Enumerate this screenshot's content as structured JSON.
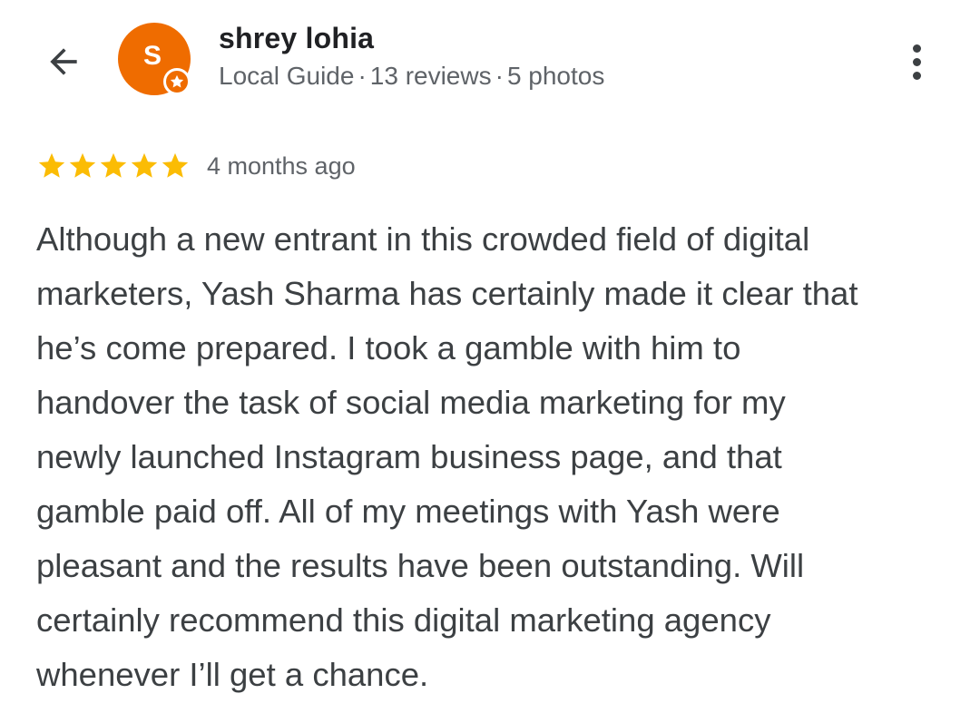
{
  "reviewer": {
    "name": "shrey lohia",
    "avatar_letter": "S",
    "avatar_color": "#ef6c00",
    "badge": "local-guide-star-icon",
    "meta": {
      "level": "Local Guide",
      "reviews": "13 reviews",
      "photos": "5 photos",
      "separator": "·"
    }
  },
  "review": {
    "stars": 5,
    "star_color": "#fbbc04",
    "time": "4 months ago",
    "lines": [
      "Although a new entrant in this crowded field of digital",
      "marketers, Yash Sharma has certainly made it clear that",
      "he’s come prepared. I took a gamble with him to",
      "handover the task of social media marketing for my",
      "newly launched Instagram business page, and that",
      "gamble paid off. All of my meetings with Yash were",
      "pleasant and the results have been outstanding. Will",
      "certainly recommend this digital marketing agency",
      "whenever I’ll get a chance."
    ]
  },
  "toolbar": {
    "back_icon": "arrow-back-icon",
    "more_icon": "more-vert-icon"
  }
}
